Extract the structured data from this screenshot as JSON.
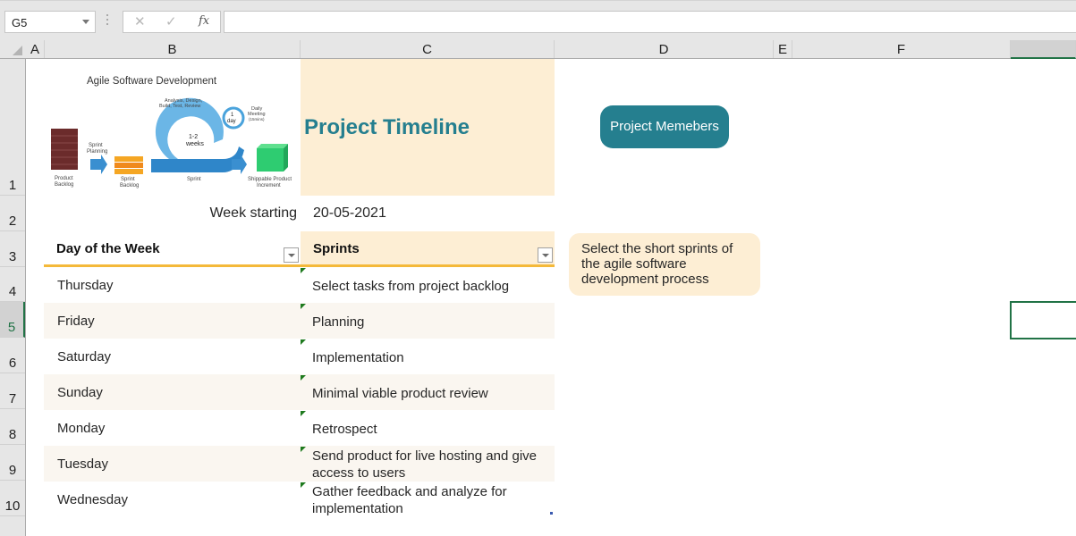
{
  "formula_bar": {
    "name_box": "G5",
    "cancel_icon": "✕",
    "enter_icon": "✓",
    "fx_label": "fx",
    "formula": ""
  },
  "columns": [
    "A",
    "B",
    "C",
    "D",
    "E",
    "F",
    ""
  ],
  "rows": [
    "1",
    "2",
    "3",
    "4",
    "5",
    "6",
    "7",
    "8",
    "9",
    "10"
  ],
  "selected_cell": "G5",
  "image": {
    "title": "Agile Software Development",
    "labels": {
      "product_backlog_1": "Product",
      "product_backlog_2": "Backlog",
      "sprint_planning_1": "Sprint",
      "sprint_planning_2": "Planning",
      "sprint_backlog_1": "Sprint",
      "sprint_backlog_2": "Backlog",
      "analysis_1": "Analysis, Design,",
      "analysis_2": "Build, Test, Review",
      "weeks_1": "1-2",
      "weeks_2": "weeks",
      "day_1": "1",
      "day_2": "day",
      "daily_1": "Daily",
      "daily_2": "Meeting",
      "daily_3": "(15mins)",
      "sprint": "Sprint",
      "shippable_1": "Shippable Product",
      "shippable_2": "Increment"
    }
  },
  "title": "Project Timeline",
  "members_button": "Project Memebers",
  "week_starting": {
    "label": "Week starting",
    "value": "20-05-2021"
  },
  "table": {
    "headers": {
      "day": "Day of the Week",
      "sprint": "Sprints"
    },
    "rows": [
      {
        "day": "Thursday",
        "sprint": "Select tasks from project backlog"
      },
      {
        "day": "Friday",
        "sprint": "Planning"
      },
      {
        "day": "Saturday",
        "sprint": "Implementation"
      },
      {
        "day": "Sunday",
        "sprint": "Minimal viable product review"
      },
      {
        "day": "Monday",
        "sprint": "Retrospect"
      },
      {
        "day": "Tuesday",
        "sprint": "Send product for live hosting and give access to users"
      },
      {
        "day": "Wednesday",
        "sprint": "Gather feedback and analyze for implementation"
      }
    ]
  },
  "note": "Select the short sprints of the agile software development process",
  "colors": {
    "accent_teal": "#257f8f",
    "header_fill": "#fdeed4",
    "header_border": "#f4b93a",
    "band_fill": "#faf6f0",
    "selection": "#217346"
  }
}
